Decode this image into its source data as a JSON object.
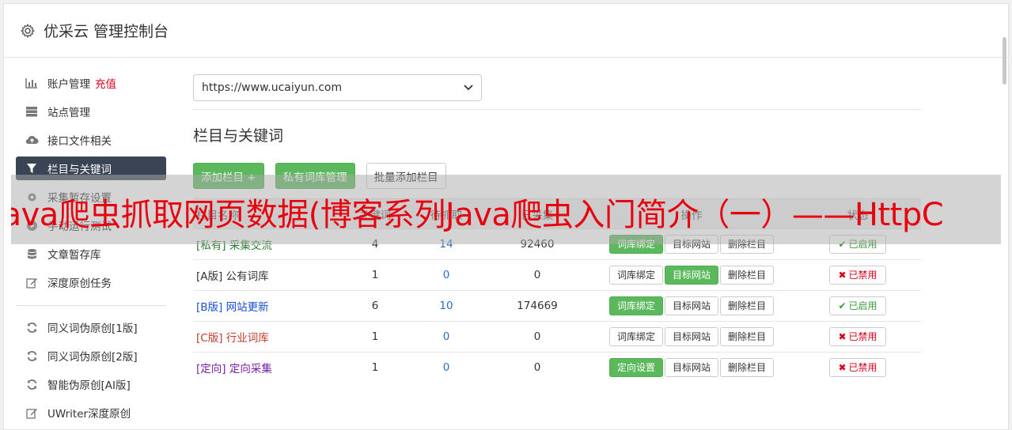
{
  "app": {
    "title": "优采云 管理控制台",
    "icon": "gear-icon"
  },
  "sidebar": {
    "items": [
      {
        "label": "账户管理",
        "extra": "充值",
        "icon": "bar-chart-icon",
        "active": false
      },
      {
        "label": "站点管理",
        "icon": "server-icon",
        "active": false
      },
      {
        "label": "接口文件相关",
        "icon": "cloud-upload-icon",
        "active": false
      },
      {
        "label": "栏目与关键词",
        "icon": "filter-icon",
        "active": true
      },
      {
        "label": "采集暂存设置",
        "icon": "cog-icon",
        "active": false
      },
      {
        "label": "手动运行测试",
        "icon": "play-icon",
        "active": false
      },
      {
        "label": "文章暂存库",
        "icon": "database-icon",
        "active": false
      },
      {
        "label": "深度原创任务",
        "icon": "edit-icon",
        "active": false
      }
    ],
    "items2": [
      {
        "label": "同义词伪原创[1版]",
        "icon": "refresh-icon"
      },
      {
        "label": "同义词伪原创[2版]",
        "icon": "refresh-icon"
      },
      {
        "label": "智能伪原创[AI版]",
        "icon": "refresh-icon"
      },
      {
        "label": "UWriter深度原创",
        "icon": "edit-icon"
      }
    ]
  },
  "site_select": {
    "value": "https://www.ucaiyun.com"
  },
  "section": {
    "title": "栏目与关键词"
  },
  "toolbar": {
    "add_column": "添加栏目 +",
    "private_lib": "私有词库管理",
    "batch_add": "批量添加栏目"
  },
  "table": {
    "headers": [
      "栏目名称",
      "关键词",
      "待抓取",
      "已采集",
      "操作",
      "状态"
    ],
    "rows": [
      {
        "tag": "[私有]",
        "name": "采集交流",
        "color": "#2e7d32",
        "keywords": "4",
        "pending": "14",
        "collected": "92460",
        "btn1": "词库绑定",
        "btn1_green": true,
        "btn2": "目标网站",
        "btn2_green": false,
        "btn3": "删除栏目",
        "status": "已启用",
        "enabled": true
      },
      {
        "tag": "[A版]",
        "name": "公有词库",
        "color": "#333333",
        "keywords": "1",
        "pending": "0",
        "collected": "0",
        "btn1": "词库绑定",
        "btn1_green": false,
        "btn2": "目标网站",
        "btn2_green": true,
        "btn3": "删除栏目",
        "status": "已禁用",
        "enabled": false
      },
      {
        "tag": "[B版]",
        "name": "网站更新",
        "color": "#1a4fd8",
        "keywords": "6",
        "pending": "10",
        "collected": "174669",
        "btn1": "词库绑定",
        "btn1_green": true,
        "btn2": "目标网站",
        "btn2_green": false,
        "btn3": "删除栏目",
        "status": "已启用",
        "enabled": true
      },
      {
        "tag": "[C版]",
        "name": "行业词库",
        "color": "#c0392b",
        "keywords": "1",
        "pending": "0",
        "collected": "0",
        "btn1": "词库绑定",
        "btn1_green": false,
        "btn2": "目标网站",
        "btn2_green": false,
        "btn3": "删除栏目",
        "status": "已禁用",
        "enabled": false
      },
      {
        "tag": "[定向]",
        "name": "定向采集",
        "color": "#7b1fa2",
        "keywords": "1",
        "pending": "0",
        "collected": "0",
        "btn1": "定向设置",
        "btn1_green": true,
        "btn2": "目标网站",
        "btn2_green": false,
        "btn3": "删除栏目",
        "status": "已禁用",
        "enabled": false
      }
    ]
  },
  "overlay": {
    "text": "java爬虫抓取网页数据(博客系列Java爬虫入门简介（一）——HttpC"
  }
}
